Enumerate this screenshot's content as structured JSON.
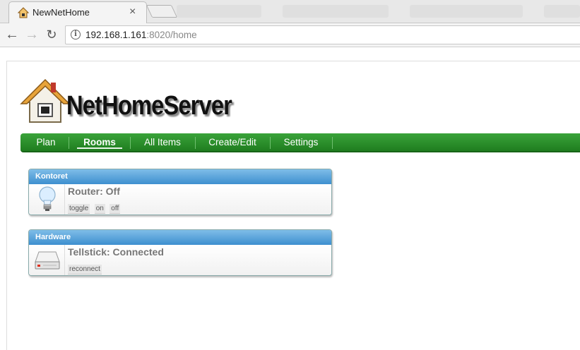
{
  "browser": {
    "tab_title": "NewNetHome",
    "url_host": "192.168.1.161",
    "url_path": ":8020/home"
  },
  "logo_text": "NetHomeServer",
  "menu": [
    {
      "label": "Plan"
    },
    {
      "label": "Rooms"
    },
    {
      "label": "All Items"
    },
    {
      "label": "Create/Edit"
    },
    {
      "label": "Settings"
    }
  ],
  "panels": [
    {
      "header": "Kontoret",
      "item_title": "Router: Off",
      "icon": "lightbulb-icon",
      "actions": [
        "toggle",
        "on",
        "off"
      ]
    },
    {
      "header": "Hardware",
      "item_title": "Tellstick: Connected",
      "icon": "hardware-device-icon",
      "actions": [
        "reconnect"
      ]
    }
  ],
  "colors": {
    "menu_green": "#2a8f2a",
    "panel_blue": "#3d8fcf"
  }
}
